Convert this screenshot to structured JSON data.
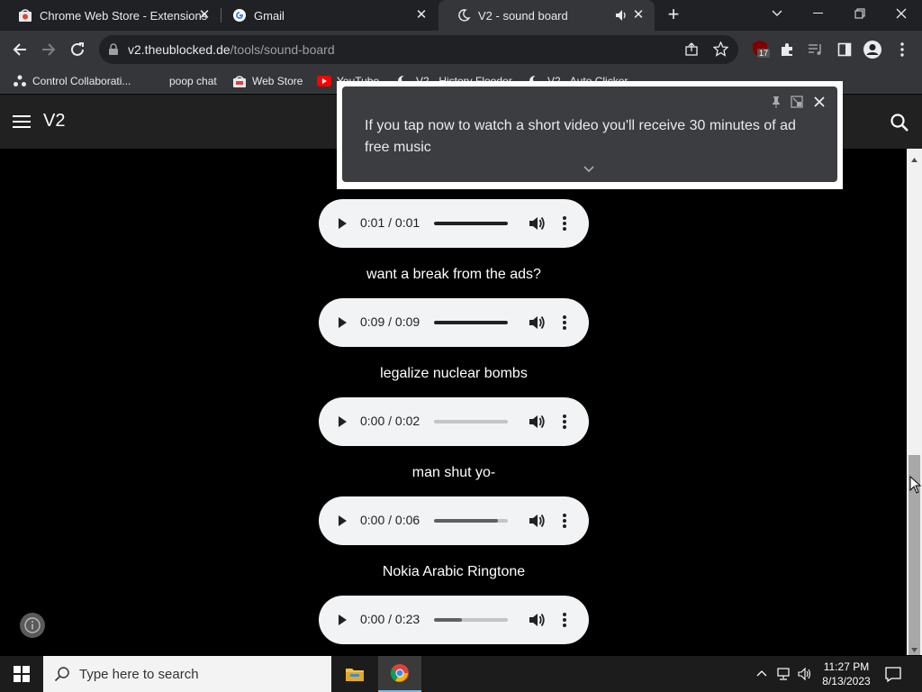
{
  "browser": {
    "tabs": [
      {
        "title": "Chrome Web Store - Extensions",
        "favicon": "chrome-web-store-icon",
        "active": false
      },
      {
        "title": "Gmail",
        "favicon": "google-g-icon",
        "active": false
      },
      {
        "title": "V2 - sound board",
        "favicon": "moon-icon",
        "active": true,
        "audio": true
      }
    ],
    "tab_close": "✕",
    "new_tab": "+",
    "url": {
      "host": "v2.theublocked.de",
      "path": "/tools/sound-board"
    },
    "extension_badge": "17",
    "bookmarks": [
      {
        "label": "Control Collaborati...",
        "icon": "control-icon"
      },
      {
        "label": "poop chat",
        "icon": "blank-icon"
      },
      {
        "label": "Web Store",
        "icon": "web-store-icon"
      },
      {
        "label": "YouTube",
        "icon": "youtube-icon"
      },
      {
        "label": "V2 - History Flooder",
        "icon": "moon-icon"
      },
      {
        "label": "V2 - Auto Clicker",
        "icon": "moon-icon"
      }
    ]
  },
  "app": {
    "brand": "V2"
  },
  "sounds": [
    {
      "label": "",
      "time": "0:01 / 0:01",
      "progress": 1.0
    },
    {
      "label": "want a break from the ads?",
      "time": "0:09 / 0:09",
      "progress": 1.0
    },
    {
      "label": "legalize nuclear bombs",
      "time": "0:00 / 0:02",
      "progress": 0.0
    },
    {
      "label": "man shut yo-",
      "time": "0:00 / 0:06",
      "progress": 0.0
    },
    {
      "label": "Nokia Arabic Ringtone",
      "time": "0:00 / 0:23",
      "progress": 0.0
    }
  ],
  "sound_buffered": [
    0.0,
    0.0,
    0.0,
    0.86,
    0.38
  ],
  "popup": {
    "message": "If you tap now to watch a short video you'll receive 30 minutes of ad free music"
  },
  "taskbar": {
    "search_placeholder": "Type here to search",
    "time": "11:27 PM",
    "date": "8/13/2023"
  },
  "colors": {
    "player_bg": "#f1f3f4",
    "page_bg": "#000000",
    "appbar_bg": "#212121",
    "accent_blue": "#76b9ed"
  }
}
